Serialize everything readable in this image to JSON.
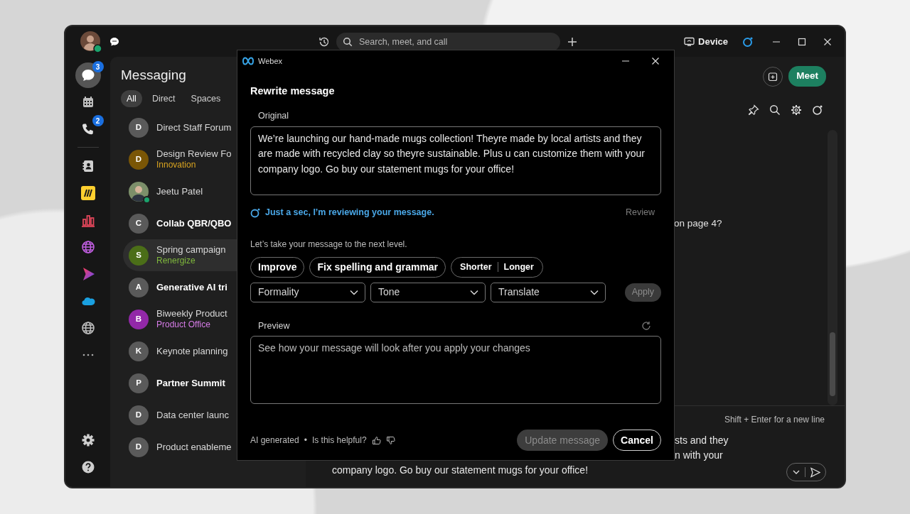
{
  "titlebar": {
    "search": {
      "placeholder": "Search, meet, and call"
    },
    "device_button": "Device"
  },
  "rail": {
    "top": [
      {
        "kind": "messaging",
        "selected": true,
        "badge": "3"
      },
      {
        "kind": "calendar",
        "selected": false
      },
      {
        "kind": "calls",
        "selected": false,
        "badge": "2"
      }
    ],
    "apps": [
      {
        "kind": "contacts",
        "selected": false
      },
      {
        "kind": "miro",
        "selected": false
      },
      {
        "kind": "chart",
        "selected": false
      },
      {
        "kind": "globe_purple",
        "selected": false
      },
      {
        "kind": "play",
        "selected": false
      },
      {
        "kind": "cloud",
        "selected": false
      },
      {
        "kind": "globe",
        "selected": false
      },
      {
        "kind": "more",
        "selected": false
      }
    ],
    "bottom": [
      {
        "kind": "settings"
      },
      {
        "kind": "help"
      }
    ]
  },
  "messaging": {
    "title": "Messaging",
    "tabs": [
      {
        "label": "All",
        "selected": true
      },
      {
        "label": "Direct",
        "selected": false
      },
      {
        "label": "Spaces",
        "selected": false
      }
    ],
    "items": [
      {
        "kind": "letter",
        "avatar": "D",
        "color": "#5a5a5a",
        "name": "Direct Staff Forum",
        "unread": false,
        "selected": false
      },
      {
        "kind": "letter",
        "avatar": "D",
        "color": "#7a5606",
        "name": "Design Review Fo",
        "subtitle": {
          "text": "Innovation",
          "color": "#d9a420"
        },
        "unread": false,
        "selected": false
      },
      {
        "kind": "photo",
        "name": "Jeetu Patel",
        "online": true,
        "unread": false,
        "selected": false
      },
      {
        "kind": "letter",
        "avatar": "C",
        "color": "#5a5a5a",
        "name": "Collab QBR/QBO",
        "unread": true,
        "selected": false
      },
      {
        "kind": "letter",
        "avatar": "S",
        "color": "#4b6e18",
        "name": "Spring campaign",
        "subtitle": {
          "text": "Renergize",
          "color": "#7fb83c"
        },
        "unread": false,
        "selected": true
      },
      {
        "kind": "letter",
        "avatar": "A",
        "color": "#5a5a5a",
        "name": "Generative AI tri",
        "unread": true,
        "selected": false
      },
      {
        "kind": "letter",
        "avatar": "B",
        "color": "#9228a8",
        "name": "Biweekly Product",
        "subtitle": {
          "text": "Product Office",
          "color": "#d77ce8"
        },
        "unread": false,
        "selected": false
      },
      {
        "kind": "letter",
        "avatar": "K",
        "color": "#5a5a5a",
        "name": "Keynote planning",
        "unread": false,
        "selected": false
      },
      {
        "kind": "letter",
        "avatar": "P",
        "color": "#5a5a5a",
        "name": "Partner Summit",
        "unread": true,
        "selected": false
      },
      {
        "kind": "letter",
        "avatar": "D",
        "color": "#5a5a5a",
        "name": "Data center launc",
        "unread": false,
        "selected": false
      },
      {
        "kind": "letter",
        "avatar": "D",
        "color": "#5a5a5a",
        "name": "Product enableme",
        "unread": false,
        "selected": false
      }
    ]
  },
  "conversation": {
    "meet_button": "Meet",
    "message": "on page 4?",
    "composer": {
      "hint": "Shift + Enter for a new line",
      "lines": [
        "sts and they",
        "n with your",
        "company logo. Go buy our statement mugs for your office!"
      ]
    }
  },
  "dialog": {
    "app_name": "Webex",
    "title": "Rewrite message",
    "original_label": "Original",
    "original_text": "We’re launching our hand-made mugs collection! Theyre made by local artists and they are made with recycled clay so theyre sustainable. Plus u can customize them with your company logo. Go buy our statement mugs for your office!",
    "status": "Just a sec, I’m reviewing your message.",
    "review_button": {
      "label": "Review",
      "disabled": true
    },
    "prompt": "Let’s take your message to the next level.",
    "actions": [
      {
        "label": "Improve"
      },
      {
        "label": "Fix spelling and grammar"
      }
    ],
    "length_options": [
      {
        "label": "Shorter"
      },
      {
        "label": "Longer"
      }
    ],
    "dropdowns": [
      {
        "label": "Formality"
      },
      {
        "label": "Tone"
      },
      {
        "label": "Translate"
      }
    ],
    "apply_button": {
      "label": "Apply",
      "disabled": true
    },
    "preview_label": "Preview",
    "preview": {
      "placeholder": "See how your message will look after you apply your changes"
    },
    "footer": {
      "ai_note": "AI generated",
      "separator": "•",
      "question": "Is this helpful?"
    },
    "update_button": {
      "label": "Update message",
      "disabled": true
    },
    "cancel_button": {
      "label": "Cancel",
      "disabled": false
    }
  }
}
